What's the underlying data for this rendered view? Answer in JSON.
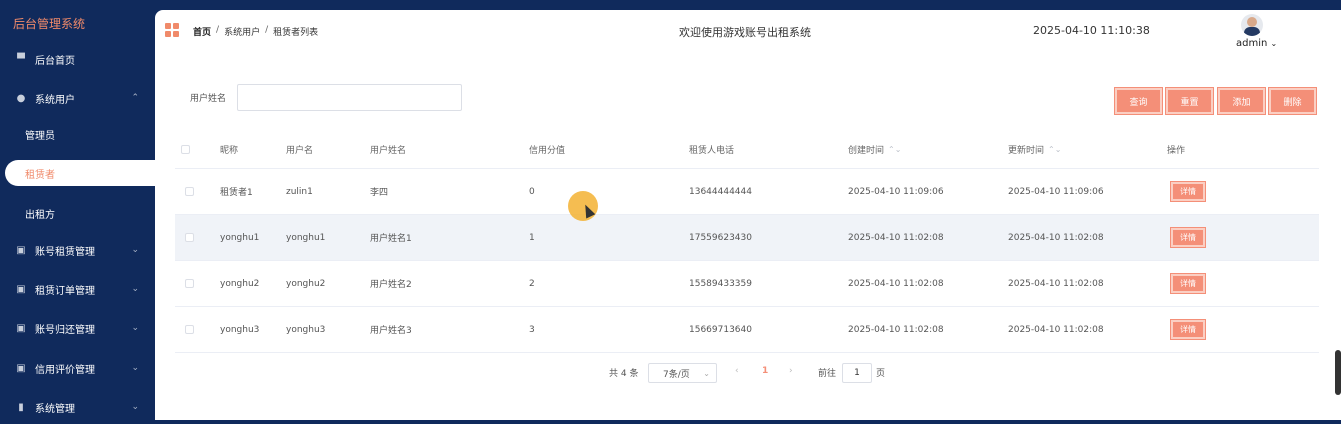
{
  "sidebar": {
    "brand": "后台管理系统",
    "home": "后台首页",
    "system_users": "系统用户",
    "sub_admin": "管理员",
    "sub_tenant": "租赁者",
    "sub_lessor": "出租方",
    "account_rental": "账号租赁管理",
    "rental_orders": "租赁订单管理",
    "account_return": "账号归还管理",
    "credit_eval": "信用评价管理",
    "system_mgmt": "系统管理"
  },
  "header": {
    "breadcrumb": [
      "首页",
      "系统用户",
      "租赁者列表"
    ],
    "breadcrumb_sep": "/",
    "welcome": "欢迎使用游戏账号出租系统",
    "datetime": "2025-04-10 11:10:38",
    "user": "admin"
  },
  "search": {
    "label": "用户姓名",
    "value": "",
    "buttons": {
      "query": "查询",
      "reset": "重置",
      "add": "添加",
      "delete": "删除"
    }
  },
  "table": {
    "columns": [
      "昵称",
      "用户名",
      "用户姓名",
      "信用分值",
      "租赁人电话",
      "创建时间",
      "更新时间",
      "操作"
    ],
    "sortable": "⌃⌄",
    "rows": [
      {
        "nickname": "租赁者1",
        "username": "zulin1",
        "realname": "李四",
        "credit": "0",
        "phone": "13644444444",
        "created": "2025-04-10 11:09:06",
        "updated": "2025-04-10 11:09:06",
        "action": "详情"
      },
      {
        "nickname": "yonghu1",
        "username": "yonghu1",
        "realname": "用户姓名1",
        "credit": "1",
        "phone": "17559623430",
        "created": "2025-04-10 11:02:08",
        "updated": "2025-04-10 11:02:08",
        "action": "详情"
      },
      {
        "nickname": "yonghu2",
        "username": "yonghu2",
        "realname": "用户姓名2",
        "credit": "2",
        "phone": "15589433359",
        "created": "2025-04-10 11:02:08",
        "updated": "2025-04-10 11:02:08",
        "action": "详情"
      },
      {
        "nickname": "yonghu3",
        "username": "yonghu3",
        "realname": "用户姓名3",
        "credit": "3",
        "phone": "15669713640",
        "created": "2025-04-10 11:02:08",
        "updated": "2025-04-10 11:02:08",
        "action": "详情"
      }
    ]
  },
  "pagination": {
    "total": "共 4 条",
    "page_size": "7条/页",
    "prev": "‹",
    "current": "1",
    "next": "›",
    "goto_label": "前往",
    "goto_value": "1",
    "page_suffix": "页"
  },
  "colors": {
    "accent": "#f48f78",
    "sidebar": "#102a5c"
  }
}
